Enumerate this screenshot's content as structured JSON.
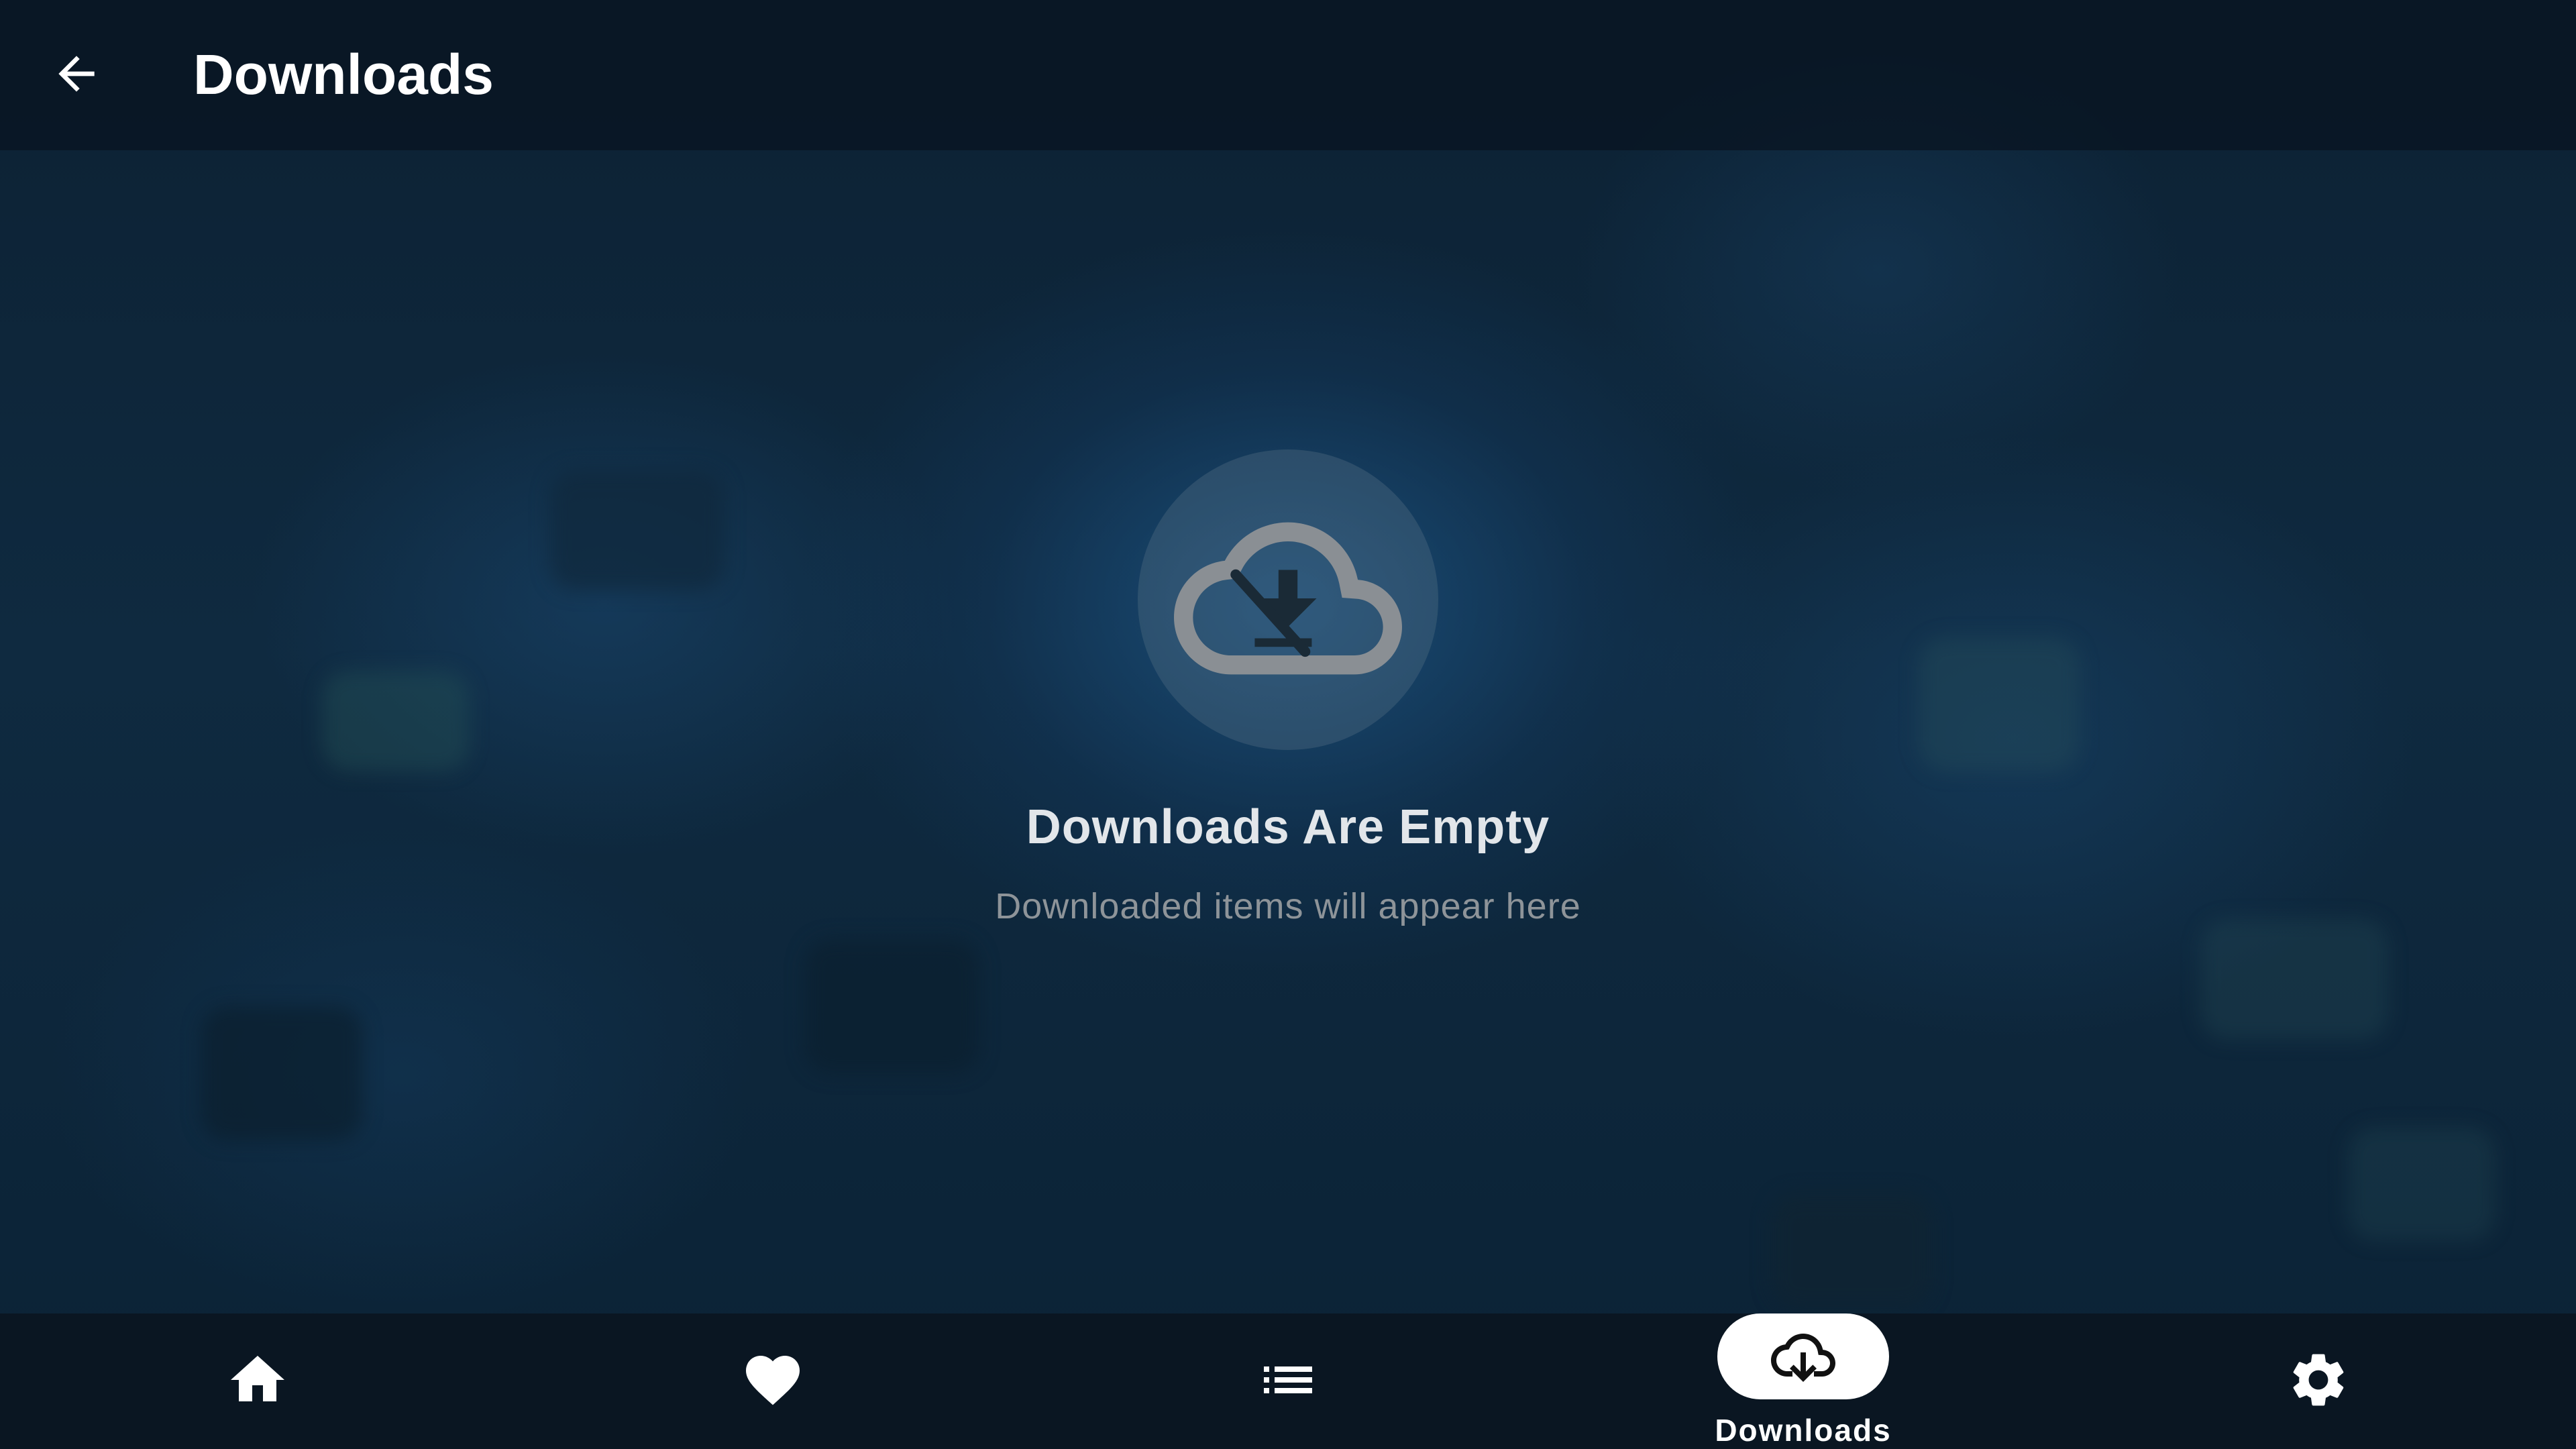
{
  "header": {
    "title": "Downloads",
    "back_icon": "arrow-back-icon"
  },
  "empty_state": {
    "icon": "cloud-download-off-icon",
    "title": "Downloads Are Empty",
    "subtitle": "Downloaded items will appear here"
  },
  "bottom_nav": {
    "items": [
      {
        "icon": "home-icon",
        "label": "",
        "active": false
      },
      {
        "icon": "heart-icon",
        "label": "",
        "active": false
      },
      {
        "icon": "list-icon",
        "label": "",
        "active": false
      },
      {
        "icon": "cloud-download-icon",
        "label": "Downloads",
        "active": true
      },
      {
        "icon": "gear-icon",
        "label": "",
        "active": false
      }
    ]
  },
  "colors": {
    "background": "#0c2133",
    "topbar": "#08141f",
    "nav_background": "#0a1622",
    "active_pill": "#ffffff",
    "title_text": "#ffffff",
    "subtitle_text": "#8e9499"
  }
}
